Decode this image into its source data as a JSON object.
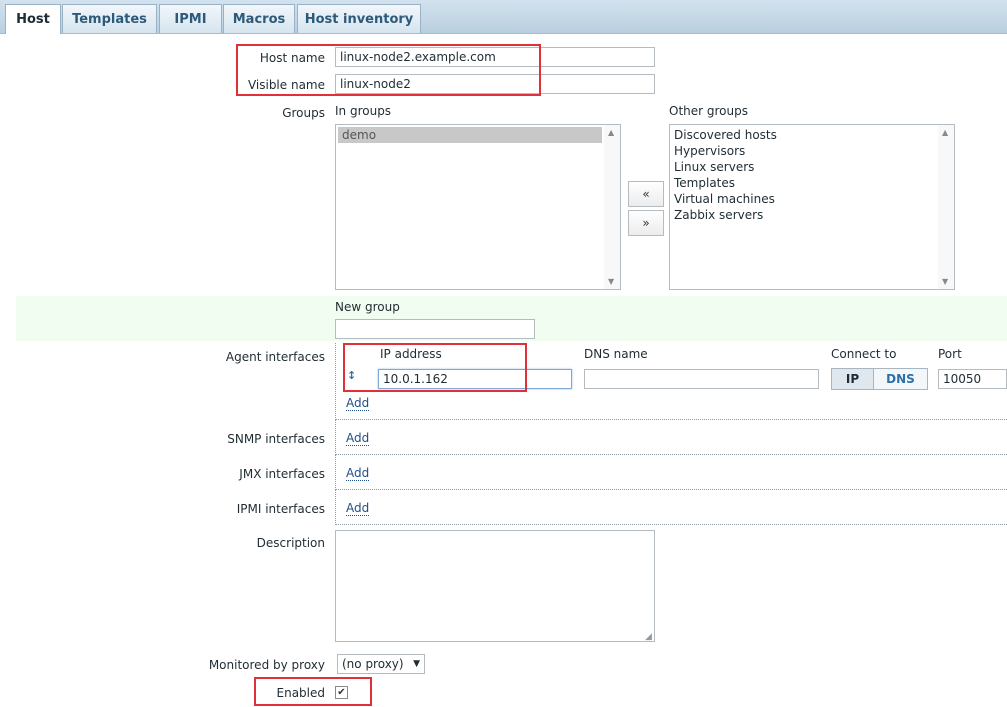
{
  "tabs": [
    {
      "label": "Host",
      "active": true
    },
    {
      "label": "Templates",
      "active": false
    },
    {
      "label": "IPMI",
      "active": false
    },
    {
      "label": "Macros",
      "active": false
    },
    {
      "label": "Host inventory",
      "active": false
    }
  ],
  "form": {
    "host_name_label": "Host name",
    "host_name_value": "linux-node2.example.com",
    "visible_name_label": "Visible name",
    "visible_name_value": "linux-node2",
    "groups_label": "Groups",
    "in_groups_label": "In groups",
    "in_groups": [
      "demo"
    ],
    "other_groups_label": "Other groups",
    "other_groups": [
      "Discovered hosts",
      "Hypervisors",
      "Linux servers",
      "Templates",
      "Virtual machines",
      "Zabbix servers"
    ],
    "move_left": "«",
    "move_right": "»",
    "new_group_label": "New group",
    "new_group_value": "",
    "agent_interfaces_label": "Agent interfaces",
    "ip_address_label": "IP address",
    "dns_name_label": "DNS name",
    "connect_to_label": "Connect to",
    "port_label": "Port",
    "ip_value": "10.0.1.162",
    "dns_value": "",
    "connect_ip": "IP",
    "connect_dns": "DNS",
    "port_value": "10050",
    "add_label": "Add",
    "snmp_interfaces_label": "SNMP interfaces",
    "jmx_interfaces_label": "JMX interfaces",
    "ipmi_interfaces_label": "IPMI interfaces",
    "description_label": "Description",
    "description_value": "",
    "monitored_by_proxy_label": "Monitored by proxy",
    "proxy_value": "(no proxy)",
    "enabled_label": "Enabled",
    "enabled_checked": "✔"
  },
  "colors": {
    "highlight_box": "#e0303a",
    "new_group_row": "#f2fdf2"
  }
}
